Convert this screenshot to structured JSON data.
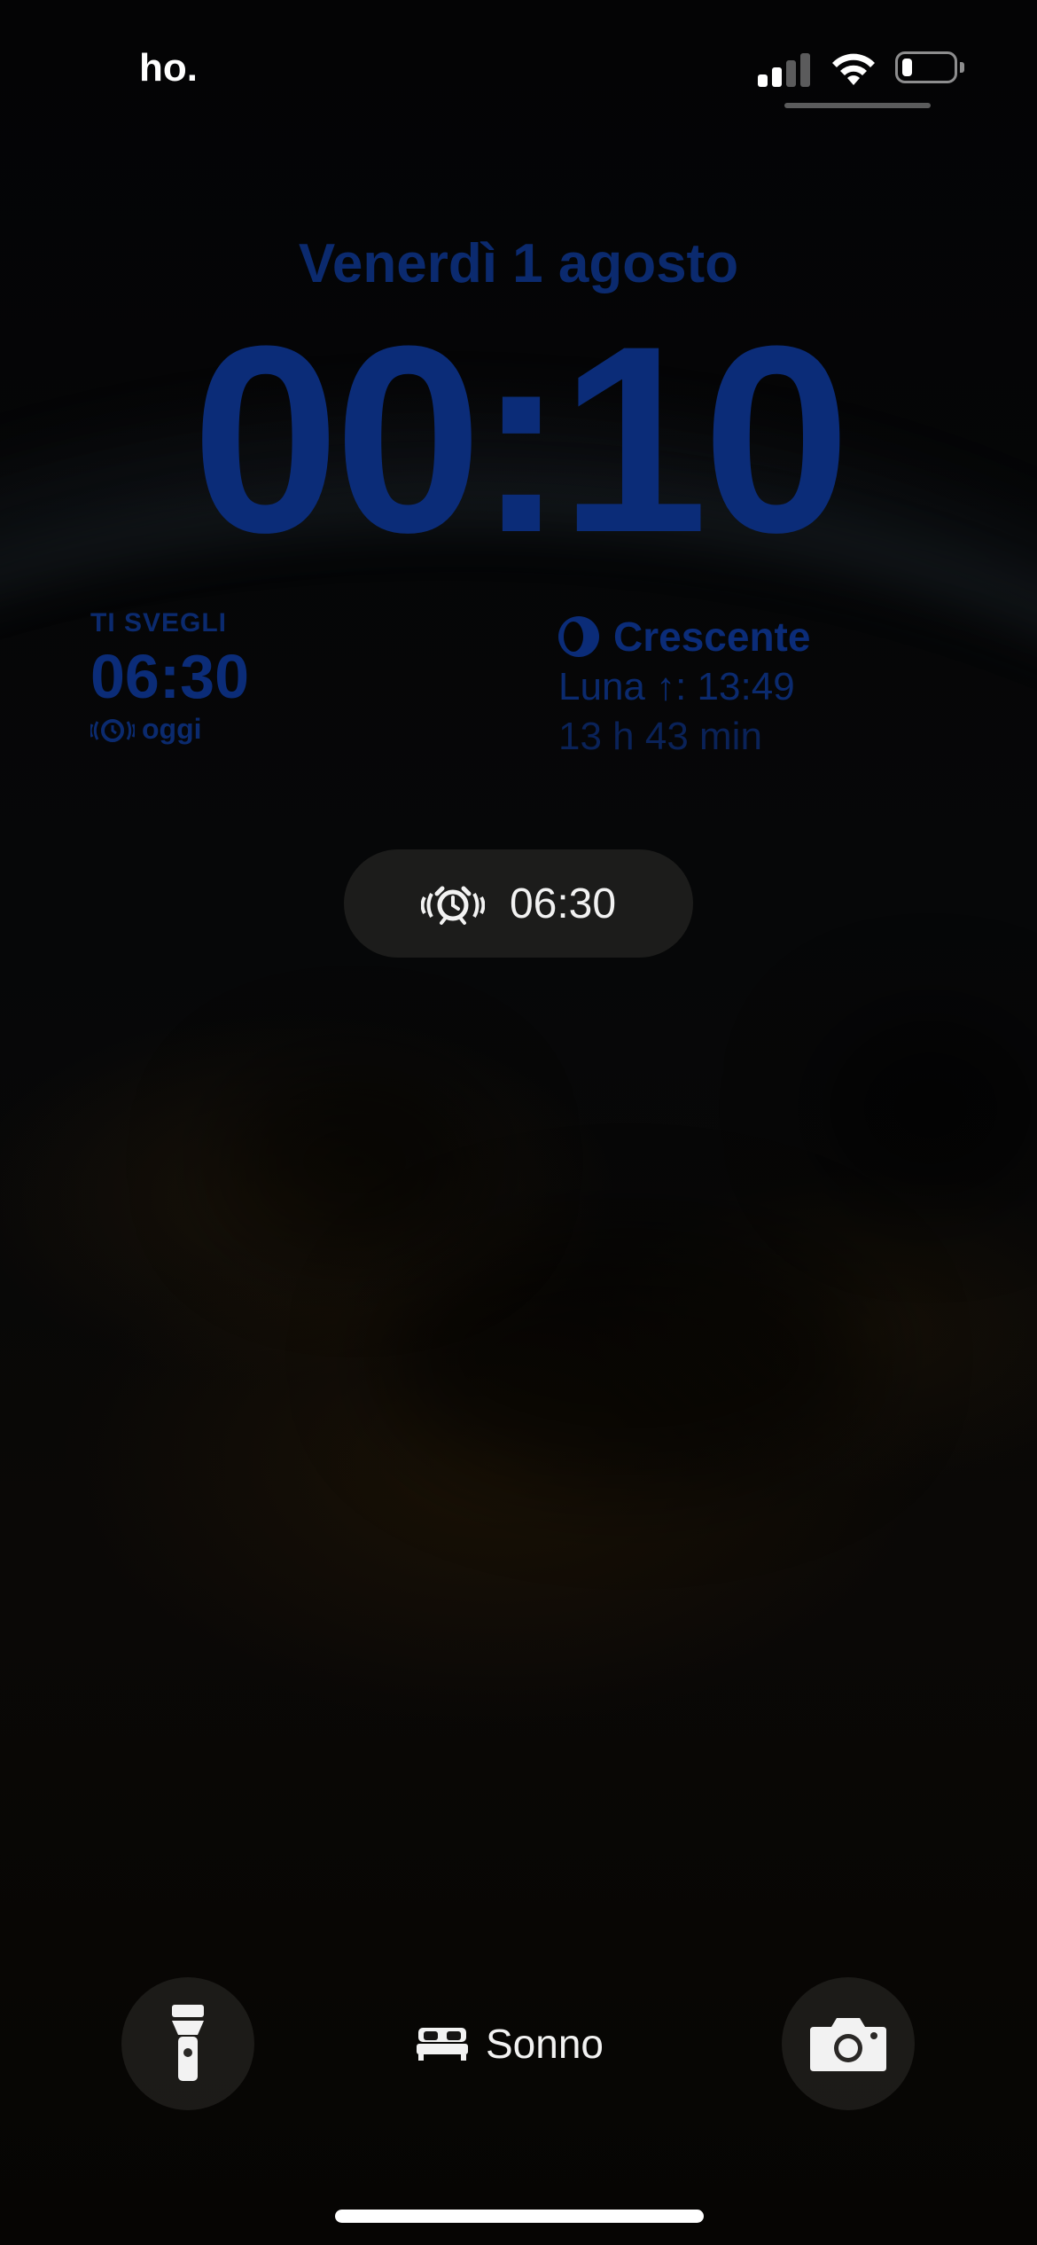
{
  "status_bar": {
    "carrier": "ho.",
    "signal_bars_active": 2,
    "signal_bars_total": 4,
    "battery_level_fraction": 0.2
  },
  "lock_screen": {
    "date": "Venerdì 1 agosto",
    "time": "00:10"
  },
  "wake_widget": {
    "label": "TI SVEGLI",
    "time": "06:30",
    "day": "oggi",
    "icon": "alarm-icon"
  },
  "moon_widget": {
    "phase": "Crescente",
    "moonrise": "Luna ↑: 13:49",
    "duration": "13 h 43 min",
    "icon": "moon-phase-icon"
  },
  "alarm_pill": {
    "time": "06:30",
    "icon": "alarm-ringing-icon"
  },
  "bottom_bar": {
    "left_icon": "flashlight-icon",
    "center_icon": "bed-icon",
    "center_label": "Sonno",
    "right_icon": "camera-icon"
  },
  "colors": {
    "widget_blue": "#0b2c78",
    "pill_background": "#242422",
    "background": "#050505"
  }
}
